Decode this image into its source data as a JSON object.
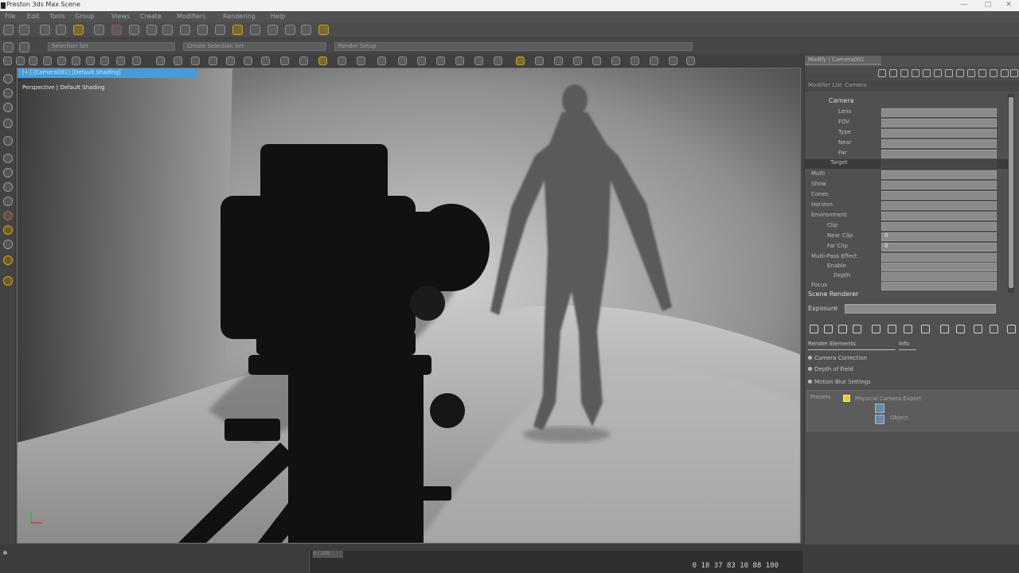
{
  "window": {
    "title": "Preston 3ds Max Scene",
    "controls": [
      "—",
      "□",
      "✕"
    ]
  },
  "menus": [
    "File",
    "Edit",
    "Tools",
    "Group",
    "Views",
    "Create",
    "Modifiers",
    "Rendering",
    "Help"
  ],
  "toolbar": {
    "tab_label_1": "Selection Set",
    "tab_label_2": "Create Selection Set",
    "tab_label_3": "Render Setup"
  },
  "viewport": {
    "header_label": "[+] [Camera001] [Default Shading]",
    "overlay_label": "Perspective | Default Shading"
  },
  "right_panel": {
    "tab_label": "Modify | Camera001",
    "sub_labels": [
      "Modifier List",
      "Camera"
    ],
    "group_label": "Camera",
    "params": [
      {
        "label": "Lens",
        "value": ""
      },
      {
        "label": "FOV",
        "value": ""
      },
      {
        "label": "Type",
        "value": ""
      },
      {
        "label": "Near",
        "value": ""
      },
      {
        "label": "Far",
        "value": ""
      },
      {
        "label": "Target",
        "value": ""
      },
      {
        "label": "Multi",
        "value": ""
      },
      {
        "label": "Show",
        "value": ""
      },
      {
        "label": "Cones",
        "value": ""
      },
      {
        "label": "Horizon",
        "value": ""
      },
      {
        "label": "Environment",
        "value": ""
      },
      {
        "label": "Clip",
        "value": ""
      },
      {
        "label": "Near Clip",
        "value": "0"
      },
      {
        "label": "Far Clip",
        "value": "0"
      },
      {
        "label": "Multi-Pass Effect",
        "value": ""
      },
      {
        "label": "Enable",
        "value": ""
      },
      {
        "label": "Depth",
        "value": ""
      },
      {
        "label": "Focus",
        "value": ""
      }
    ],
    "section_title": "Scene Renderer",
    "slider_label": "Exposure",
    "tabs2": [
      "Render Elements",
      "Info"
    ],
    "list_items": [
      "Camera Correction",
      "Depth of Field",
      "Motion Blur Settings"
    ],
    "box_texts": [
      "Presets",
      "Physical Camera Export",
      "Object"
    ]
  },
  "timeline": {
    "head_label": "0 / 100",
    "frames": "0 18 37 83 10 88 100"
  }
}
